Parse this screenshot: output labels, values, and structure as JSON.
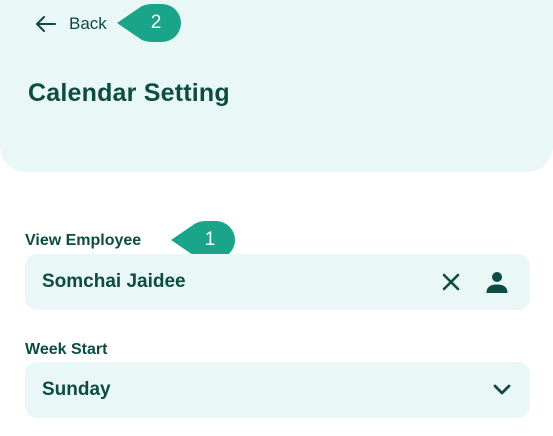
{
  "header": {
    "back_label": "Back",
    "title": "Calendar Setting"
  },
  "callouts": [
    {
      "number": "2"
    },
    {
      "number": "1"
    }
  ],
  "view_employee": {
    "label": "View Employee",
    "value": "Somchai Jaidee",
    "clear_icon": "close-icon",
    "person_icon": "person-icon"
  },
  "week_start": {
    "label": "Week Start",
    "value": "Sunday",
    "dropdown_icon": "chevron-down-icon"
  },
  "colors": {
    "panel": "#e9f7f6",
    "text": "#0d4c41",
    "callout": "#1aa58a"
  }
}
